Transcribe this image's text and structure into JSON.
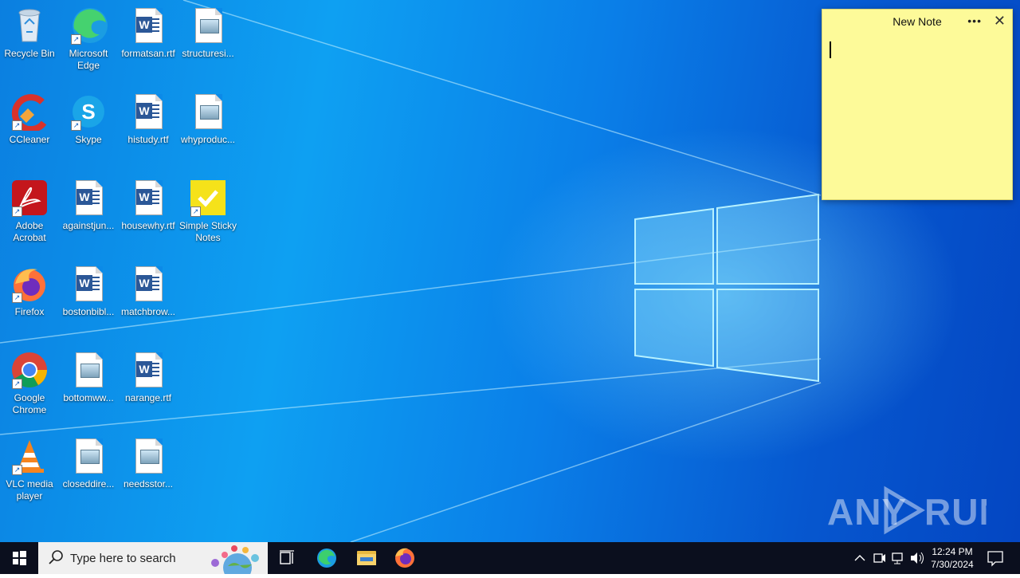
{
  "desktop": {
    "icons": [
      {
        "label": "Recycle Bin",
        "type": "recycle"
      },
      {
        "label": "Microsoft Edge",
        "type": "edge"
      },
      {
        "label": "formatsan.rtf",
        "type": "word"
      },
      {
        "label": "structuresi...",
        "type": "image"
      },
      {
        "label": "CCleaner",
        "type": "ccleaner"
      },
      {
        "label": "Skype",
        "type": "skype"
      },
      {
        "label": "histudy.rtf",
        "type": "word"
      },
      {
        "label": "whyproduc...",
        "type": "image"
      },
      {
        "label": "Adobe Acrobat",
        "type": "acrobat"
      },
      {
        "label": "againstjun...",
        "type": "word"
      },
      {
        "label": "housewhy.rtf",
        "type": "word"
      },
      {
        "label": "Simple Sticky Notes",
        "type": "sticky"
      },
      {
        "label": "Firefox",
        "type": "firefox"
      },
      {
        "label": "bostonbibl...",
        "type": "word"
      },
      {
        "label": "matchbrow...",
        "type": "word"
      },
      {
        "label": "Google Chrome",
        "type": "chrome"
      },
      {
        "label": "bottomww...",
        "type": "image"
      },
      {
        "label": "narange.rtf",
        "type": "word"
      },
      {
        "label": "VLC media player",
        "type": "vlc"
      },
      {
        "label": "closeddire...",
        "type": "image"
      },
      {
        "label": "needsstor...",
        "type": "image"
      }
    ]
  },
  "sticky_note": {
    "title": "New Note",
    "more_icon": "more-horizontal-icon",
    "close_icon": "close-icon",
    "background": "#fdfa99"
  },
  "watermark": {
    "text": "ANY RUN"
  },
  "taskbar": {
    "search_placeholder": "Type here to search",
    "pinned": [
      "task-view",
      "edge",
      "file-explorer",
      "firefox"
    ],
    "clock_time": "12:24 PM",
    "clock_date": "7/30/2024"
  }
}
